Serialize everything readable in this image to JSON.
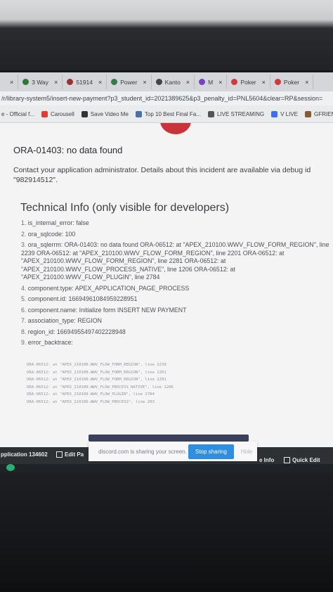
{
  "tabs": [
    {
      "label": "",
      "icon": "close-icon",
      "color": "#555"
    },
    {
      "label": "3 Way",
      "icon": "c-icon",
      "color": "#2c7a3a"
    },
    {
      "label": "51914",
      "icon": "puzzle-icon",
      "color": "#a03030"
    },
    {
      "label": "Power",
      "icon": "leaf-icon",
      "color": "#2f7d4a"
    },
    {
      "label": "Kanto",
      "icon": "triangle-icon",
      "color": "#444"
    },
    {
      "label": "M",
      "icon": "app-icon",
      "color": "#7b3fc4"
    },
    {
      "label": "Poker",
      "icon": "star-icon",
      "color": "#d23a3a"
    },
    {
      "label": "Poker",
      "icon": "star-icon",
      "color": "#d23a3a"
    }
  ],
  "address": "/r/library-system5/insert-new-payment?p3_student_id=2021389625&p3_penalty_id=PNL5604&clear=RP&session=",
  "bookmarks": [
    {
      "label": "e - Official f...",
      "icon": "none",
      "color": "#888"
    },
    {
      "label": "Carousell",
      "icon": "carousell-icon",
      "color": "#e53935"
    },
    {
      "label": "Save Video Me",
      "icon": "video-icon",
      "color": "#333"
    },
    {
      "label": "Top 10 Best Final Fa...",
      "icon": "site-icon",
      "color": "#4b6fa8"
    },
    {
      "label": "LIVE STREAMING",
      "icon": "stream-icon",
      "color": "#555"
    },
    {
      "label": "V LIVE",
      "icon": "vlive-icon",
      "color": "#3b6ff0"
    },
    {
      "label": "GFRIEN",
      "icon": "gfriend-icon",
      "color": "#8a5a2b"
    }
  ],
  "error": {
    "title": "ORA-01403: no data found",
    "message": "Contact your application administrator. Details about this incident are available via debug id \"982914512\"."
  },
  "technical": {
    "title": "Technical Info (only visible for developers)",
    "items": [
      {
        "num": "1.",
        "text": "is_internal_error: false"
      },
      {
        "num": "2.",
        "text": "ora_sqlcode: 100"
      },
      {
        "num": "3.",
        "text": "ora_sqlerrm: ORA-01403: no data found ORA-06512: at \"APEX_210100.WWV_FLOW_FORM_REGION\", line 2239 ORA-06512: at \"APEX_210100.WWV_FLOW_FORM_REGION\", line 2201 ORA-06512: at \"APEX_210100.WWV_FLOW_FORM_REGION\", line 2281 ORA-06512: at \"APEX_210100.WWV_FLOW_PROCESS_NATIVE\", line 1206 ORA-06512: at \"APEX_210100.WWV_FLOW_PLUGIN\", line 2784"
      },
      {
        "num": "4.",
        "text": "component.type: APEX_APPLICATION_PAGE_PROCESS"
      },
      {
        "num": "5.",
        "text": "component.id: 16694961084959228951"
      },
      {
        "num": "6.",
        "text": "component.name: Initialize form INSERT NEW PAYMENT"
      },
      {
        "num": "7.",
        "text": "association_type: REGION"
      },
      {
        "num": "8.",
        "text": "region_id: 16694955497402228948"
      },
      {
        "num": "9.",
        "text": "error_backtrace:"
      }
    ],
    "backtrace": [
      "ORA-06512: at \"APEX_210100.WWV_FLOW_FORM_REGION\", line 2239",
      "ORA-06512: at \"APEX_210100.WWV_FLOW_FORM_REGION\", line 2201",
      "ORA-06512: at \"APEX_210100.WWV_FLOW_FORM_REGION\", line 2281",
      "ORA-06512: at \"APEX_210100.WWV_FLOW_PROCESS_NATIVE\", line 1206",
      "ORA-06512: at \"APEX_210100.WWV_FLOW_PLUGIN\", line 2784",
      "ORA-06512: at \"APEX_210100.WWV_FLOW_PROCESS\", line 203"
    ]
  },
  "share": {
    "message": "discord.com is sharing your screen.",
    "stop_label": "Stop sharing",
    "hide_label": "Hide"
  },
  "devbar": {
    "application": "pplication 134602",
    "edit": "Edit Pa",
    "info": "e Info",
    "quick_edit": "Quick Edit"
  },
  "colors": {
    "accent": "#2f8ee0",
    "error_icon": "#c9343a"
  }
}
